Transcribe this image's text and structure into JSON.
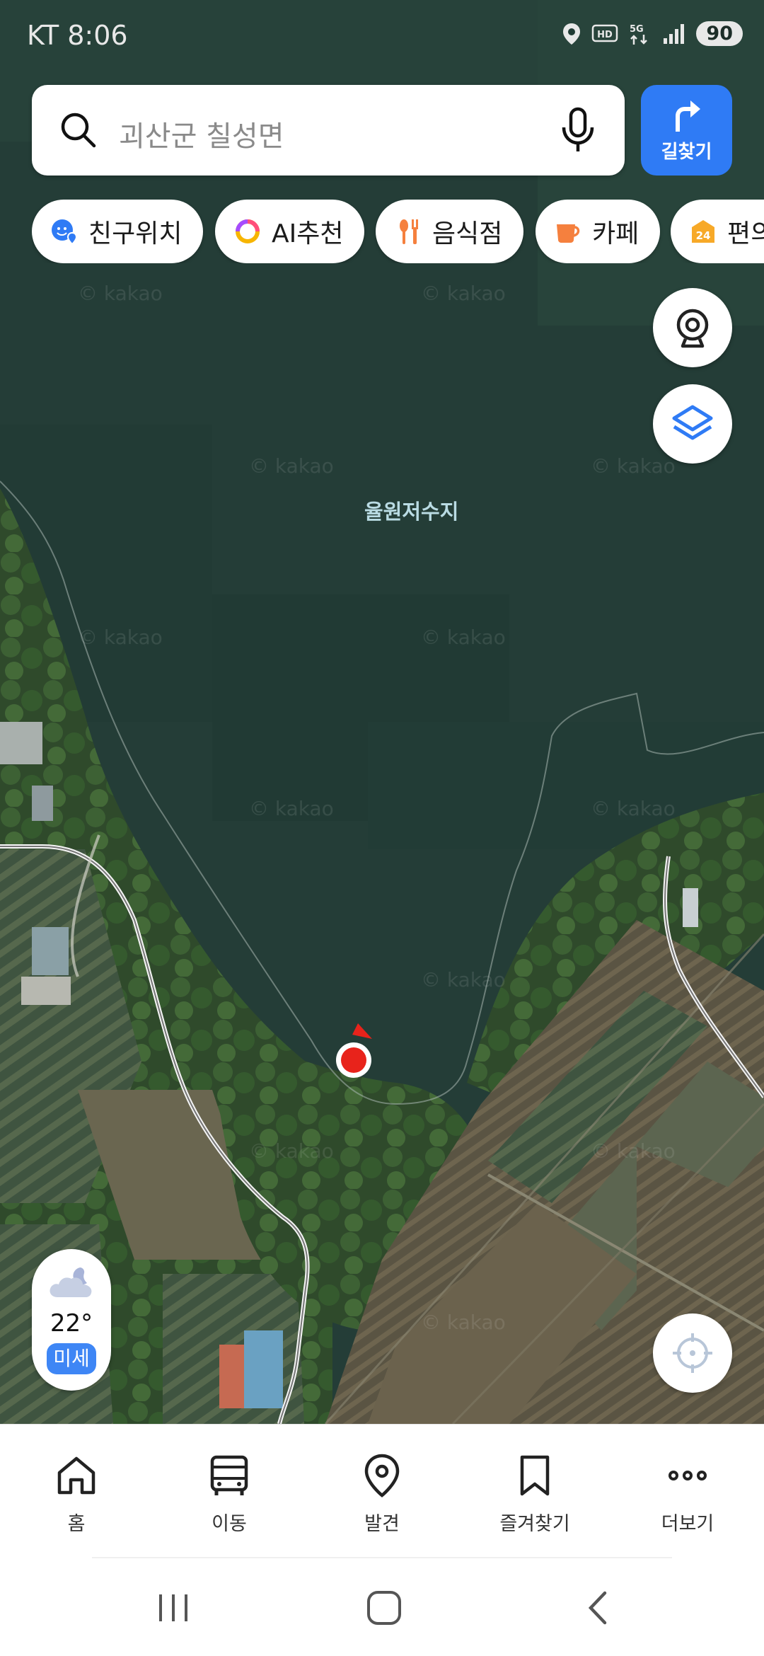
{
  "status_bar": {
    "carrier_time": "KT 8:06",
    "icons": [
      "location-icon",
      "hd-icon",
      "5g-icon",
      "signal-icon"
    ],
    "battery": "90"
  },
  "search": {
    "placeholder": "괴산군 칠성면"
  },
  "route_button": {
    "label": "길찾기"
  },
  "chips": [
    {
      "label": "친구위치",
      "icon": "friend-location-icon"
    },
    {
      "label": "AI추천",
      "icon": "ai-ring-icon"
    },
    {
      "label": "음식점",
      "icon": "restaurant-icon"
    },
    {
      "label": "카페",
      "icon": "cafe-icon"
    },
    {
      "label": "편의점",
      "icon": "convenience-store-icon"
    }
  ],
  "map": {
    "place_label": "율원저수지",
    "watermark": "© kakao"
  },
  "weather": {
    "temperature": "22°",
    "air_quality": "미세"
  },
  "bottom_nav": {
    "items": [
      {
        "label": "홈",
        "icon": "home-icon"
      },
      {
        "label": "이동",
        "icon": "bus-icon"
      },
      {
        "label": "발견",
        "icon": "pin-icon"
      },
      {
        "label": "즐겨찾기",
        "icon": "bookmark-icon"
      },
      {
        "label": "더보기",
        "icon": "more-icon"
      }
    ]
  },
  "colors": {
    "accent": "#2f7bf5",
    "marker": "#e8231b",
    "water": "#243d37"
  }
}
